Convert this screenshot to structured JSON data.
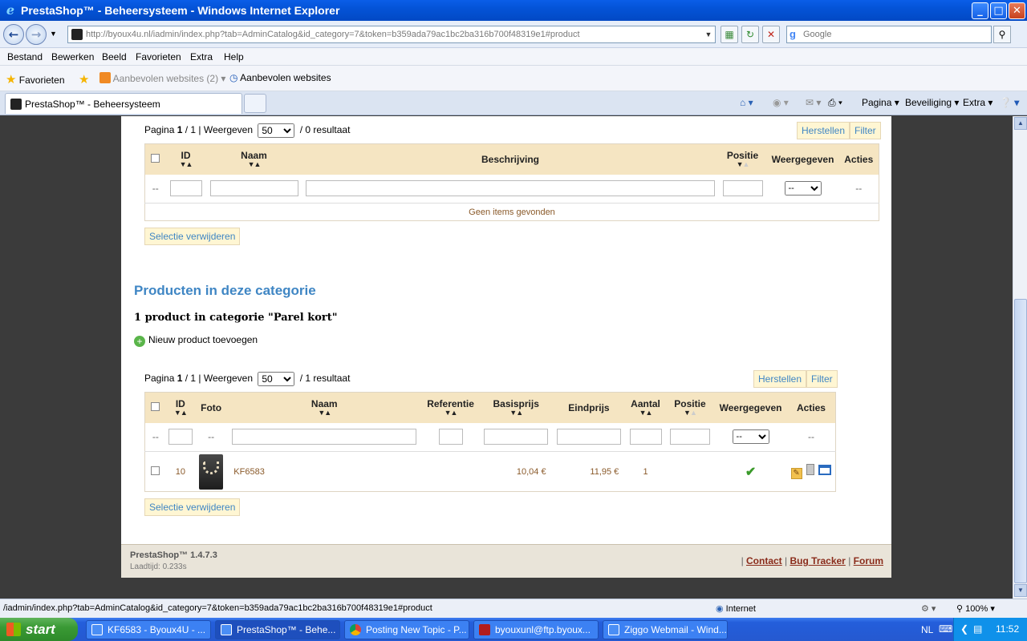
{
  "window": {
    "title": "PrestaShop™ - Beheersysteem - Windows Internet Explorer",
    "minimize": "_",
    "maximize": "□",
    "close": "✕"
  },
  "address": {
    "url": "http://byoux4u.nl/iadmin/index.php?tab=AdminCatalog&id_category=7&token=b359ada79ac1bc2ba316b700f48319e1#product",
    "search_placeholder": "Google"
  },
  "menu": [
    "Bestand",
    "Bewerken",
    "Beeld",
    "Favorieten",
    "Extra",
    "Help"
  ],
  "favorites": {
    "label": "Favorieten",
    "recommended": "Aanbevolen websites (2)",
    "recommended2": "Aanbevolen websites"
  },
  "tabs": {
    "active": "PrestaShop™ - Beheersysteem"
  },
  "commands": {
    "page": "Pagina",
    "security": "Beveiliging",
    "extra": "Extra"
  },
  "top_list": {
    "page_prefix": "Pagina",
    "page_current": "1",
    "page_sep": "/ 1 | Weergeven",
    "per_page": "50",
    "result": "/ 0 resultaat",
    "reset": "Herstellen",
    "filter": "Filter",
    "columns": {
      "id": "ID",
      "name": "Naam",
      "description": "Beschrijving",
      "position": "Positie",
      "shown": "Weergegeven",
      "actions": "Acties"
    },
    "filter_dash": "--",
    "empty": "Geen items gevonden",
    "delete_selection": "Selectie verwijderen"
  },
  "products_section": {
    "title": "Producten in deze categorie",
    "subtitle": "1 product in categorie \"Parel kort\"",
    "add_product": "Nieuw product toevoegen"
  },
  "product_list": {
    "page_prefix": "Pagina",
    "page_current": "1",
    "page_sep": "/ 1 | Weergeven",
    "per_page": "50",
    "result": "/ 1 resultaat",
    "reset": "Herstellen",
    "filter": "Filter",
    "columns": {
      "id": "ID",
      "photo": "Foto",
      "name": "Naam",
      "reference": "Referentie",
      "base_price": "Basisprijs",
      "final_price": "Eindprijs",
      "quantity": "Aantal",
      "position": "Positie",
      "shown": "Weergegeven",
      "actions": "Acties"
    },
    "filter_dash": "--",
    "rows": [
      {
        "id": "10",
        "name": "KF6583",
        "reference": "",
        "base_price": "10,04 €",
        "final_price": "11,95 €",
        "quantity": "1",
        "position": ""
      }
    ],
    "delete_selection": "Selectie verwijderen"
  },
  "footer": {
    "version": "PrestaShop™ 1.4.7.3",
    "load_time": "Laadtijd: 0.233s",
    "contact": "Contact",
    "bug_tracker": "Bug Tracker",
    "forum": "Forum"
  },
  "status": {
    "url": "/iadmin/index.php?tab=AdminCatalog&id_category=7&token=b359ada79ac1bc2ba316b700f48319e1#product",
    "zone": "Internet",
    "zoom": "100%"
  },
  "taskbar": {
    "start": "start",
    "tasks": [
      "KF6583 - Byoux4U - ...",
      "PrestaShop™ - Behe...",
      "Posting New Topic - P...",
      "byouxunl@ftp.byoux...",
      "Ziggo Webmail - Wind..."
    ],
    "lang": "NL",
    "time": "11:52"
  },
  "colors": {
    "accent": "#3f86c4",
    "table_header": "#f5e5c2",
    "button_bg": "#fff6d3",
    "link_footer": "#8a2c1b"
  }
}
